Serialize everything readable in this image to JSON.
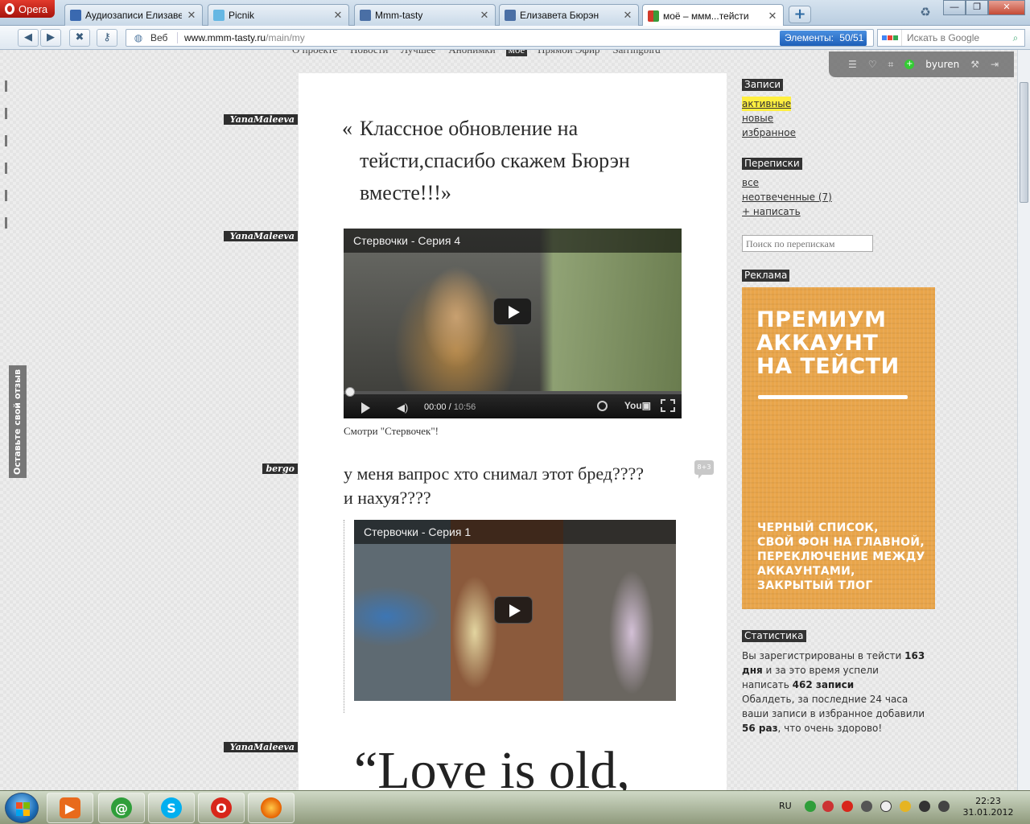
{
  "browser": {
    "menu_label": "Opera",
    "tabs": [
      {
        "label": "Аудиозаписи Елизаве...",
        "color": "#3a69b0"
      },
      {
        "label": "Picnik",
        "color": "#65b7e3"
      },
      {
        "label": "Mmm-tasty",
        "color": "#4a6fa5"
      },
      {
        "label": "Елизавета Бюрэн",
        "color": "#4a6fa5"
      },
      {
        "label": "моё – ммм...тейсти",
        "color": "#d13a2a"
      }
    ],
    "new_tab_label": "+",
    "address_prefix": "Веб",
    "url_host": "www.mmm-tasty.ru",
    "url_path": "/main/my",
    "elements_label": "Элементы:",
    "elements_count": "50/51",
    "search_placeholder": "Искать в Google"
  },
  "site": {
    "top_nav": [
      "О проекте",
      "Новости",
      "Лучшее",
      "Анонимки",
      "моё",
      "Прямой Эфир",
      "Sarringbird"
    ],
    "top_nav_active": "моё",
    "user_panel": {
      "username": "byuren"
    },
    "feedback_tab": "Оставьте свой отзыв",
    "posts": [
      {
        "author": "YanaMaleeva",
        "type": "quote",
        "text": "Классное обновление на тейсти,спасибо скажем Бюрэн вместе!!!",
        "open_quote": "«",
        "close_quote": "»"
      },
      {
        "author": "YanaMaleeva",
        "type": "video",
        "video_title": "Стервочки - Серия 4",
        "time_current": "00:00",
        "time_total": "10:56",
        "caption": "Смотри \"Стервочек\"!"
      },
      {
        "author": "bergo",
        "type": "text_video",
        "text": "у меня вапрос хто снимал этот бред????и нахуя????",
        "video_title": "Стервочки - Серия 1",
        "comments_badge": "8+3"
      },
      {
        "author": "YanaMaleeva",
        "type": "quote",
        "text": "“Love is old,"
      }
    ],
    "sidebar": {
      "posts_header": "Записи",
      "posts_links": [
        "активные",
        "новые",
        "избранное"
      ],
      "posts_active": "активные",
      "messages_header": "Переписки",
      "messages_links": [
        "все",
        "неотвеченные (7)",
        "+ написать"
      ],
      "messages_search_placeholder": "Поиск по перепискам",
      "ad_header": "Реклама",
      "ad_title_lines": [
        "ПРЕМИУМ",
        "АККАУНТ",
        "НА ТЕЙСТИ"
      ],
      "ad_features_lines": [
        "ЧЕРНЫЙ СПИСОК,",
        "СВОЙ ФОН НА ГЛАВНОЙ,",
        "ПЕРЕКЛЮЧЕНИЕ МЕЖДУ",
        "АККАУНТАМИ,",
        "ЗАКРЫТЫЙ ТЛОГ"
      ],
      "stats_header": "Статистика",
      "stats_line1_a": "Вы зарегистрированы в тейсти ",
      "stats_days": "163 дня",
      "stats_line1_b": " и за это время успели написать ",
      "stats_entries": "462 записи",
      "stats_line2_a": "Обалдеть, за последние 24 часа ваши записи в избранное добавили ",
      "stats_times": "56 раз",
      "stats_line2_b": ", что очень здорово!"
    }
  },
  "taskbar": {
    "lang": "RU",
    "time": "22:23",
    "date": "31.01.2012"
  }
}
